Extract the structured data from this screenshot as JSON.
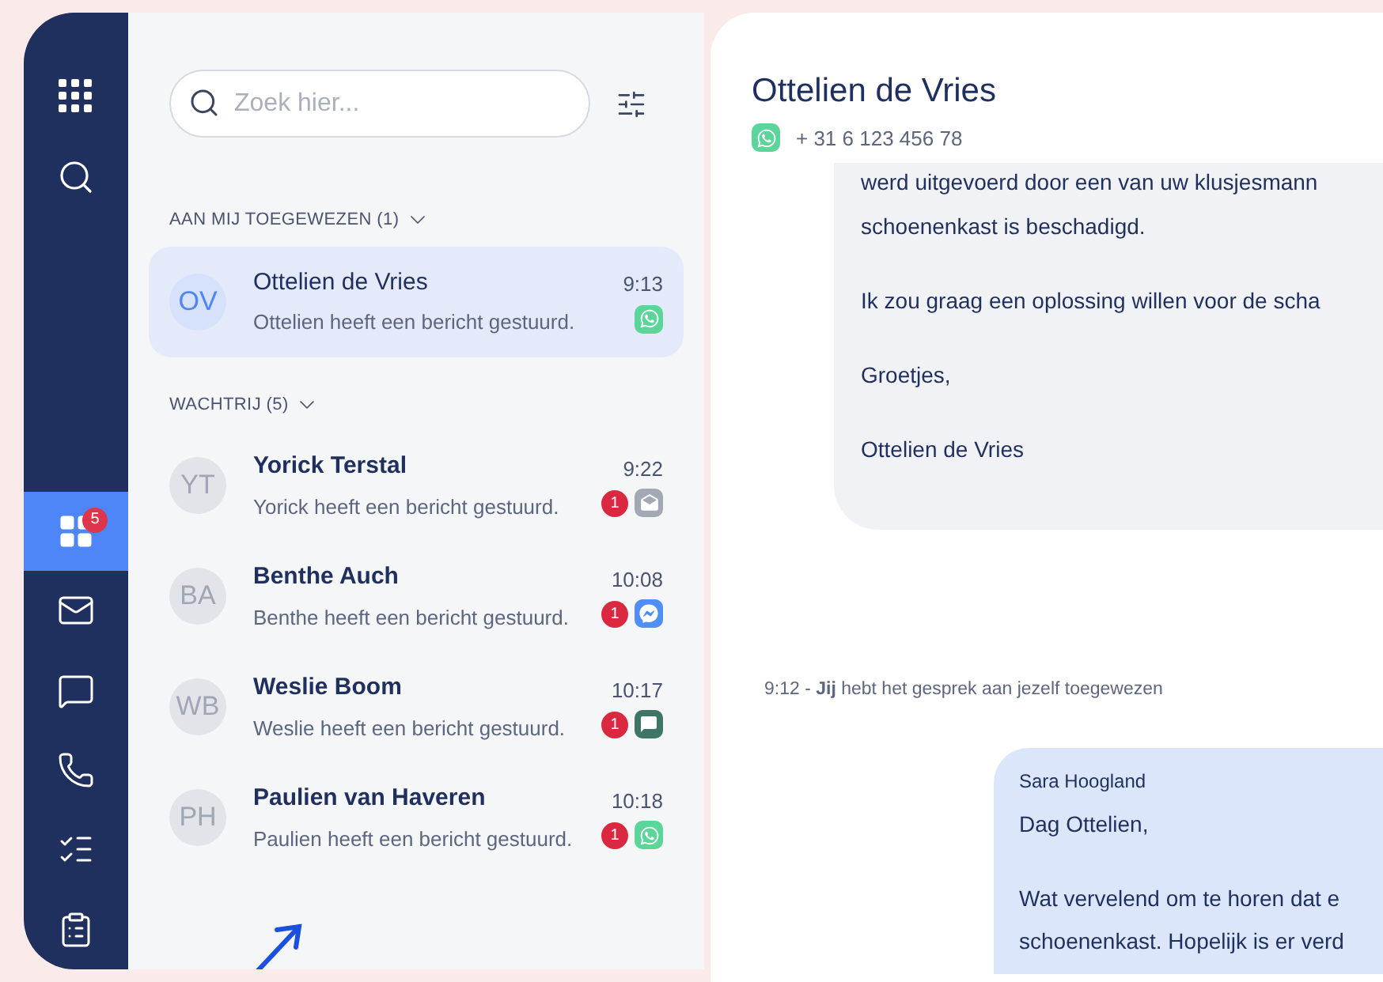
{
  "sidebar": {
    "items": [
      {
        "kind": "apps",
        "selected": false
      },
      {
        "kind": "search",
        "selected": false
      },
      {
        "kind": "dashboard",
        "selected": true,
        "badge": "5"
      },
      {
        "kind": "mail",
        "selected": false
      },
      {
        "kind": "chat",
        "selected": false
      },
      {
        "kind": "phone",
        "selected": false
      },
      {
        "kind": "tasks",
        "selected": false
      },
      {
        "kind": "clipboard",
        "selected": false
      }
    ]
  },
  "search": {
    "placeholder": "Zoek hier..."
  },
  "sections": [
    {
      "title": "AAN MIJ TOEGEWEZEN (1)",
      "expanded": true,
      "conversations": [
        {
          "initials": "OV",
          "name": "Ottelien de Vries",
          "time": "9:13",
          "preview": "Ottelien heeft een bericht gestuurd.",
          "channel": {
            "kind": "whatsapp"
          },
          "selected": true,
          "unread": false
        }
      ]
    },
    {
      "title": "WACHTRIJ (5)",
      "expanded": true,
      "conversations": [
        {
          "initials": "YT",
          "name": "Yorick Terstal",
          "time": "9:22",
          "preview": "Yorick heeft een bericht gestuurd.",
          "channel": {
            "kind": "email"
          },
          "selected": false,
          "unread": true,
          "badge": "1"
        },
        {
          "initials": "BA",
          "name": "Benthe Auch",
          "time": "10:08",
          "preview": "Benthe heeft een bericht gestuurd.",
          "channel": {
            "kind": "messenger"
          },
          "selected": false,
          "unread": true,
          "badge": "1"
        },
        {
          "initials": "WB",
          "name": "Weslie Boom",
          "time": "10:17",
          "preview": "Weslie heeft een bericht gestuurd.",
          "channel": {
            "kind": "sms"
          },
          "selected": false,
          "unread": true,
          "badge": "1"
        },
        {
          "initials": "PH",
          "name": "Paulien van Haveren",
          "time": "10:18",
          "preview": "Paulien heeft een bericht gestuurd.",
          "channel": {
            "kind": "whatsapp"
          },
          "selected": false,
          "unread": true,
          "badge": "1"
        }
      ]
    }
  ],
  "chat": {
    "contact": {
      "name": "Ottelien de Vries",
      "phone": "+ 31 6 123 456 78",
      "channel": {
        "kind": "whatsapp"
      }
    },
    "messages": [
      {
        "kind": "incoming",
        "paragraphs": [
          [
            "werd uitgevoerd door een van uw klusjesmann",
            "schoenenkast is beschadigd."
          ],
          [
            "Ik zou graag een oplossing willen voor de scha"
          ],
          [
            "Groetjes,"
          ],
          [
            "Ottelien de Vries"
          ]
        ]
      },
      {
        "kind": "event",
        "text": "9:12 - **Jij** hebt het gesprek aan jezelf toegewezen"
      },
      {
        "kind": "outgoing",
        "sender": "Sara Hoogland",
        "paragraphs": [
          [
            "Dag Ottelien,"
          ],
          [
            "Wat vervelend om te horen dat e",
            "schoenenkast. Hopelijk is er verd"
          ]
        ]
      }
    ]
  }
}
